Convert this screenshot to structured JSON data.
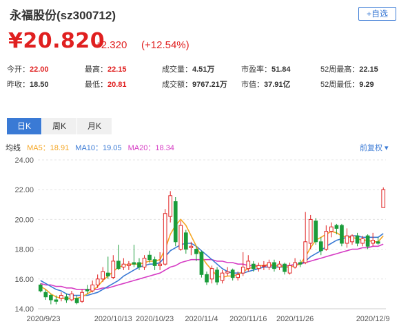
{
  "header": {
    "title": "永福股份(sz300712)",
    "add_button": "+自选"
  },
  "quote": {
    "price": "¥20.820",
    "change": "+2.320",
    "change_pct": "(+12.54%)"
  },
  "stats": [
    {
      "label": "今开：",
      "value": "22.00",
      "color": "red"
    },
    {
      "label": "最高：",
      "value": "22.15",
      "color": "red"
    },
    {
      "label": "成交量：",
      "value": "4.51万",
      "color": "normal"
    },
    {
      "label": "市盈率：",
      "value": "51.84",
      "color": "normal"
    },
    {
      "label": "52周最高：",
      "value": "22.15",
      "color": "normal"
    },
    {
      "label": "昨收：",
      "value": "18.50",
      "color": "normal"
    },
    {
      "label": "最低：",
      "value": "20.81",
      "color": "red"
    },
    {
      "label": "成交额：",
      "value": "9767.21万",
      "color": "normal"
    },
    {
      "label": "市值：",
      "value": "37.91亿",
      "color": "normal"
    },
    {
      "label": "52周最低：",
      "value": "9.29",
      "color": "normal"
    }
  ],
  "tabs": [
    "日K",
    "周K",
    "月K"
  ],
  "ma_legend": {
    "label": "均线",
    "ma5": "MA5：18.91",
    "ma10": "MA10：19.05",
    "ma20": "MA20：18.34",
    "adjust": "前复权 ▾"
  },
  "colors": {
    "up": "#e02020",
    "down": "#1a9c3a",
    "ma5": "#f5a623",
    "ma10": "#3a7ad5",
    "ma20": "#d63cc4",
    "accent": "#3a7ad5"
  },
  "chart_data": {
    "type": "candlestick",
    "ylim": [
      14.0,
      24.0
    ],
    "yticks": [
      "24.00",
      "22.00",
      "20.00",
      "18.00",
      "16.00",
      "14.00"
    ],
    "xticks": [
      "2020/9/23",
      "2020/10/13",
      "2020/10/23",
      "2020/11/4",
      "2020/11/16",
      "2020/11/26",
      "2020/12/9"
    ],
    "candles": [
      [
        15.6,
        15.2,
        15.7,
        15.1
      ],
      [
        15.1,
        14.8,
        15.3,
        14.6
      ],
      [
        14.9,
        14.6,
        15.0,
        14.3
      ],
      [
        14.6,
        14.5,
        14.9,
        14.3
      ],
      [
        14.7,
        14.9,
        15.1,
        14.5
      ],
      [
        14.8,
        14.6,
        15.0,
        14.4
      ],
      [
        14.6,
        15.0,
        15.2,
        14.5
      ],
      [
        14.7,
        14.4,
        14.9,
        14.3
      ],
      [
        14.5,
        15.1,
        15.3,
        14.4
      ],
      [
        15.3,
        15.2,
        15.6,
        15.0
      ],
      [
        15.2,
        15.6,
        15.9,
        15.1
      ],
      [
        15.6,
        16.0,
        16.3,
        15.4
      ],
      [
        16.0,
        16.5,
        16.8,
        15.8
      ],
      [
        16.4,
        16.2,
        17.5,
        16.0
      ],
      [
        16.1,
        17.2,
        17.6,
        16.0
      ],
      [
        17.2,
        16.7,
        18.3,
        16.6
      ],
      [
        16.8,
        17.0,
        17.4,
        16.6
      ],
      [
        16.9,
        17.0,
        17.2,
        16.6
      ],
      [
        17.1,
        17.0,
        18.3,
        16.8
      ],
      [
        17.1,
        16.8,
        17.4,
        16.6
      ],
      [
        16.8,
        17.4,
        17.6,
        16.6
      ],
      [
        17.6,
        17.3,
        17.9,
        17.1
      ],
      [
        17.3,
        16.9,
        17.5,
        16.6
      ],
      [
        16.9,
        17.0,
        17.8,
        16.6
      ],
      [
        17.0,
        20.4,
        20.7,
        16.9
      ],
      [
        20.2,
        21.6,
        21.9,
        19.8
      ],
      [
        21.2,
        18.5,
        21.5,
        18.2
      ],
      [
        18.0,
        19.6,
        19.9,
        17.9
      ],
      [
        19.1,
        18.0,
        19.3,
        17.7
      ],
      [
        18.1,
        18.2,
        18.5,
        17.6
      ],
      [
        18.0,
        17.7,
        18.2,
        17.2
      ],
      [
        17.8,
        16.3,
        17.9,
        16.1
      ],
      [
        16.3,
        15.8,
        16.5,
        15.6
      ],
      [
        16.0,
        16.7,
        16.9,
        15.7
      ],
      [
        16.6,
        15.8,
        16.8,
        15.6
      ],
      [
        15.9,
        16.4,
        16.6,
        15.7
      ],
      [
        16.4,
        16.5,
        16.8,
        16.2
      ],
      [
        16.6,
        16.1,
        16.7,
        15.9
      ],
      [
        16.1,
        16.3,
        16.5,
        15.9
      ],
      [
        16.4,
        16.8,
        17.8,
        16.2
      ],
      [
        16.7,
        17.2,
        17.6,
        16.5
      ],
      [
        17.0,
        16.7,
        17.2,
        16.5
      ],
      [
        16.7,
        16.9,
        17.1,
        16.5
      ],
      [
        16.9,
        16.9,
        17.2,
        16.6
      ],
      [
        16.8,
        17.1,
        17.3,
        16.6
      ],
      [
        17.1,
        16.7,
        17.3,
        16.5
      ],
      [
        16.8,
        17.0,
        17.2,
        16.6
      ],
      [
        17.0,
        16.5,
        17.1,
        16.3
      ],
      [
        16.4,
        16.9,
        17.1,
        16.3
      ],
      [
        16.8,
        17.1,
        17.4,
        16.7
      ],
      [
        17.1,
        17.0,
        17.3,
        16.8
      ],
      [
        17.1,
        18.5,
        20.5,
        17.0
      ],
      [
        18.4,
        20.0,
        20.3,
        18.0
      ],
      [
        19.9,
        18.5,
        20.1,
        18.3
      ],
      [
        18.5,
        17.9,
        18.8,
        17.6
      ],
      [
        18.0,
        19.2,
        19.6,
        17.9
      ],
      [
        19.2,
        19.5,
        19.8,
        18.8
      ],
      [
        19.6,
        19.4,
        19.7,
        19.0
      ],
      [
        19.6,
        18.4,
        19.7,
        18.2
      ],
      [
        18.4,
        18.9,
        19.4,
        18.1
      ],
      [
        18.5,
        18.9,
        19.0,
        18.3
      ],
      [
        18.9,
        18.4,
        19.1,
        18.2
      ],
      [
        18.4,
        18.7,
        18.9,
        18.2
      ],
      [
        18.9,
        18.2,
        19.0,
        18.0
      ],
      [
        18.4,
        18.6,
        19.1,
        18.2
      ],
      [
        18.5,
        18.4,
        18.8,
        18.3
      ],
      [
        20.8,
        22.0,
        22.15,
        20.81
      ]
    ],
    "ma5": [
      15.5,
      15.3,
      15.0,
      14.8,
      14.7,
      14.7,
      14.7,
      14.7,
      14.8,
      15.0,
      15.2,
      15.5,
      15.9,
      16.2,
      16.5,
      16.8,
      16.9,
      17.0,
      17.0,
      17.0,
      17.1,
      17.2,
      17.2,
      17.3,
      18.0,
      19.0,
      19.6,
      20.0,
      19.6,
      18.9,
      18.2,
      17.5,
      17.0,
      16.6,
      16.2,
      16.1,
      16.2,
      16.2,
      16.3,
      16.5,
      16.7,
      16.8,
      16.9,
      16.9,
      17.0,
      16.9,
      16.9,
      16.8,
      16.8,
      16.9,
      17.0,
      17.5,
      18.1,
      18.6,
      18.8,
      19.0,
      19.2,
      19.1,
      18.9,
      18.8,
      18.8,
      18.7,
      18.6,
      18.6,
      18.5,
      18.5,
      18.9
    ],
    "ma10": [
      15.9,
      15.7,
      15.5,
      15.3,
      15.2,
      15.0,
      14.9,
      14.9,
      14.9,
      14.9,
      15.0,
      15.1,
      15.3,
      15.5,
      15.7,
      15.9,
      16.2,
      16.4,
      16.6,
      16.8,
      16.9,
      17.0,
      17.0,
      17.1,
      17.5,
      17.9,
      18.1,
      18.3,
      18.4,
      18.4,
      18.2,
      17.9,
      17.6,
      17.3,
      17.0,
      16.7,
      16.5,
      16.4,
      16.4,
      16.4,
      16.5,
      16.6,
      16.7,
      16.8,
      16.8,
      16.8,
      16.8,
      16.8,
      16.8,
      16.9,
      17.0,
      17.2,
      17.5,
      17.7,
      17.9,
      18.2,
      18.4,
      18.6,
      18.7,
      18.8,
      18.9,
      18.9,
      18.8,
      18.8,
      18.8,
      18.8,
      19.05
    ],
    "ma20": [
      15.7,
      15.6,
      15.6,
      15.5,
      15.5,
      15.4,
      15.4,
      15.3,
      15.3,
      15.3,
      15.3,
      15.3,
      15.4,
      15.4,
      15.5,
      15.6,
      15.7,
      15.8,
      15.9,
      16.0,
      16.1,
      16.2,
      16.3,
      16.4,
      16.6,
      16.8,
      16.9,
      17.1,
      17.2,
      17.3,
      17.3,
      17.3,
      17.3,
      17.3,
      17.2,
      17.2,
      17.1,
      17.1,
      17.0,
      17.0,
      16.9,
      16.9,
      16.9,
      16.9,
      16.9,
      16.9,
      16.9,
      16.9,
      16.9,
      17.0,
      17.0,
      17.1,
      17.2,
      17.3,
      17.4,
      17.5,
      17.6,
      17.7,
      17.8,
      17.9,
      18.0,
      18.0,
      18.1,
      18.1,
      18.2,
      18.2,
      18.34
    ]
  }
}
